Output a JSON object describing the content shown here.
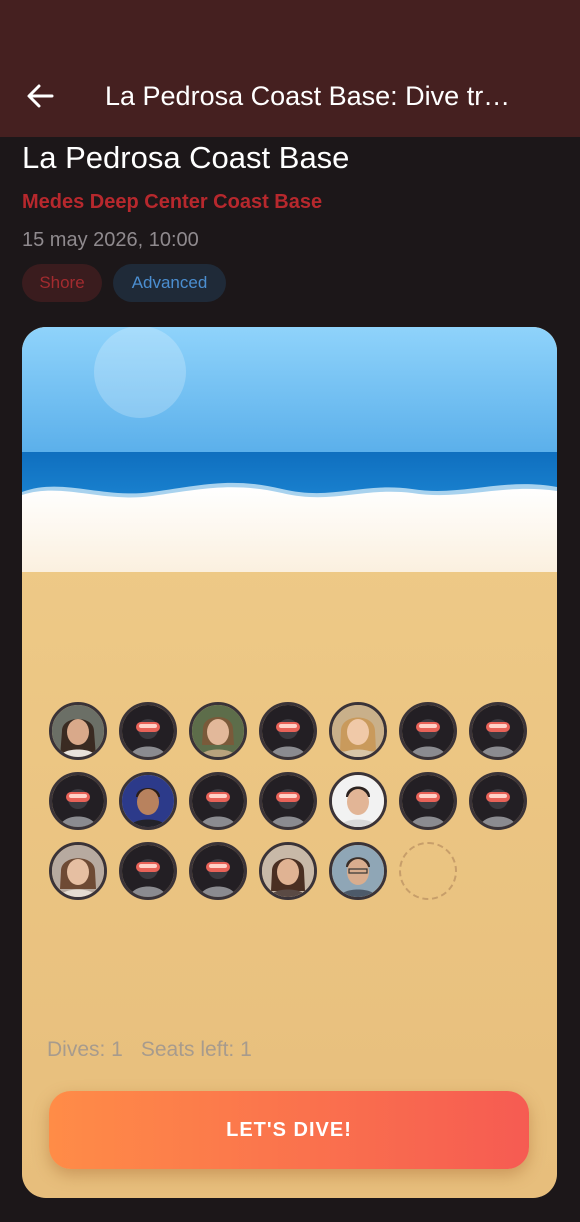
{
  "appbar": {
    "title": "La Pedrosa Coast Base: Dive tr…"
  },
  "dive": {
    "title": "La Pedrosa Coast Base",
    "center": "Medes Deep Center Coast Base",
    "datetime": "15 may 2026, 10:00",
    "tags": [
      "Shore",
      "Advanced"
    ]
  },
  "colors": {
    "appbar": "#452020",
    "background": "#1c1719",
    "accent_red": "#b7282d",
    "chip_blue": "#4b8ed0",
    "button_start": "#ff8c47",
    "button_end": "#f65b52",
    "sand": "#e9c27f"
  },
  "divers": {
    "rows": [
      [
        "photo",
        "diver-mask",
        "photo",
        "diver-mask",
        "photo",
        "diver-mask",
        "diver-mask"
      ],
      [
        "diver-mask",
        "photo",
        "diver-mask",
        "diver-mask",
        "photo",
        "diver-mask",
        "diver-mask"
      ],
      [
        "photo",
        "diver-mask",
        "diver-mask",
        "photo",
        "photo",
        "empty-seat"
      ]
    ]
  },
  "stats": {
    "dives": "Dives: 1",
    "seats_left": "Seats left: 1"
  },
  "cta": {
    "label": "LET'S DIVE!"
  }
}
